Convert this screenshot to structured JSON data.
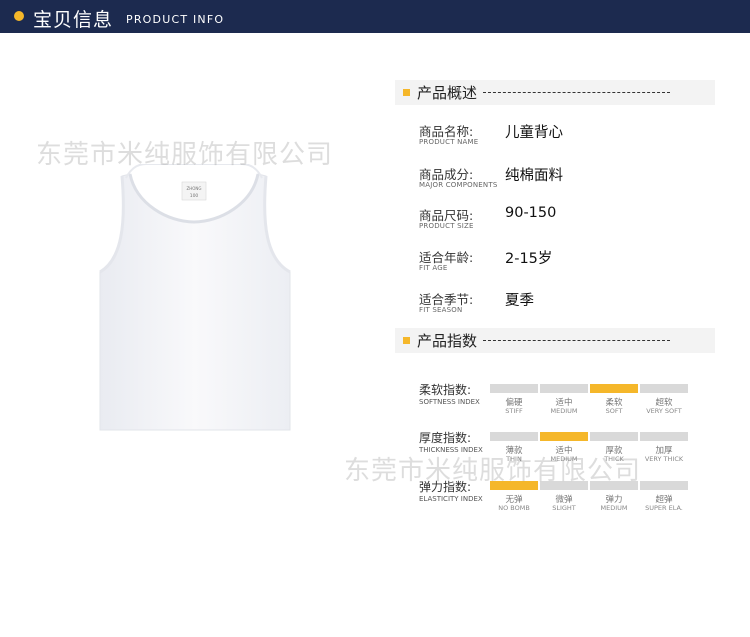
{
  "header": {
    "title_cn": "宝贝信息",
    "title_en": "PRODUCT INFO"
  },
  "watermark": "东莞市米纯服饰有限公司",
  "product_image": {
    "tag_line1": "ZHONG",
    "tag_line2": "100"
  },
  "overview": {
    "title": "产品概述",
    "rows": [
      {
        "label_cn": "商品名称:",
        "label_en": "PRODUCT NAME",
        "value": "儿童背心"
      },
      {
        "label_cn": "商品成分:",
        "label_en": "MAJOR COMPONENTS",
        "value": "纯棉面料"
      },
      {
        "label_cn": "商品尺码:",
        "label_en": "PRODUCT SIZE",
        "value": "90-150"
      },
      {
        "label_cn": "适合年龄:",
        "label_en": "FIT AGE",
        "value": "2-15岁"
      },
      {
        "label_cn": "适合季节:",
        "label_en": "FIT SEASON",
        "value": "夏季"
      }
    ]
  },
  "index": {
    "title": "产品指数",
    "rows": [
      {
        "label_cn": "柔软指数:",
        "label_en": "SOFTNESS INDEX",
        "selected": 2,
        "options": [
          {
            "cn": "偏硬",
            "en": "STIFF"
          },
          {
            "cn": "适中",
            "en": "MEDIUM"
          },
          {
            "cn": "柔软",
            "en": "SOFT"
          },
          {
            "cn": "超软",
            "en": "VERY SOFT"
          }
        ]
      },
      {
        "label_cn": "厚度指数:",
        "label_en": "THICKNESS INDEX",
        "selected": 1,
        "options": [
          {
            "cn": "薄款",
            "en": "THIN"
          },
          {
            "cn": "适中",
            "en": "MEDIUM"
          },
          {
            "cn": "厚款",
            "en": "THICK"
          },
          {
            "cn": "加厚",
            "en": "VERY THICK"
          }
        ]
      },
      {
        "label_cn": "弹力指数:",
        "label_en": "ELASTICITY INDEX",
        "selected": 0,
        "options": [
          {
            "cn": "无弹",
            "en": "NO BOMB"
          },
          {
            "cn": "微弹",
            "en": "SLIGHT"
          },
          {
            "cn": "弹力",
            "en": "MEDIUM"
          },
          {
            "cn": "超弹",
            "en": "SUPER ELA."
          }
        ]
      }
    ]
  },
  "colors": {
    "header_bg": "#1c2a4f",
    "accent": "#f5b72a",
    "bar_off": "#d9d9d9"
  }
}
